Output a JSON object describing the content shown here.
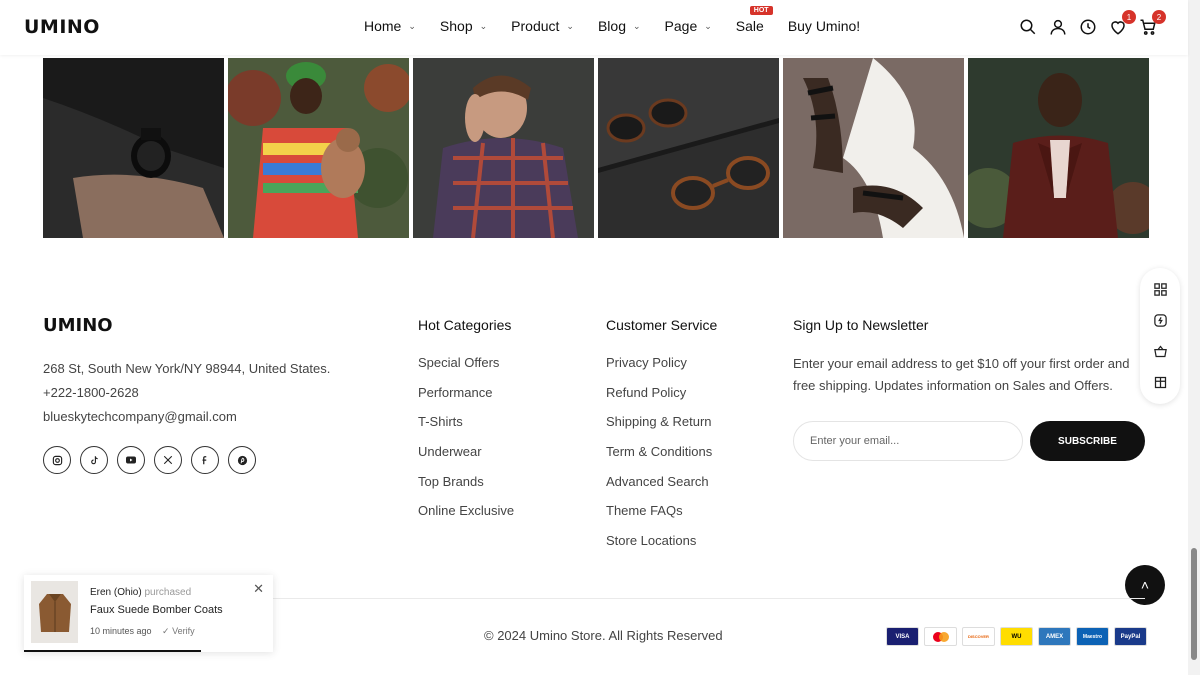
{
  "header": {
    "logo": "UMINO",
    "nav": [
      {
        "label": "Home",
        "dropdown": true
      },
      {
        "label": "Shop",
        "dropdown": true
      },
      {
        "label": "Product",
        "dropdown": true
      },
      {
        "label": "Blog",
        "dropdown": true
      },
      {
        "label": "Page",
        "dropdown": true
      },
      {
        "label": "Sale",
        "dropdown": false,
        "badge": "HOT"
      },
      {
        "label": "Buy Umino!",
        "dropdown": false
      }
    ],
    "wishlist_count": "1",
    "cart_count": "2",
    "icons": [
      "search-icon",
      "user-icon",
      "clock-icon",
      "heart-icon",
      "cart-icon"
    ]
  },
  "gallery": [
    "watch",
    "man-with-baby",
    "man-in-plaid",
    "sunglasses",
    "sandals",
    "man-in-velvet-blazer"
  ],
  "footer": {
    "logo": "UMINO",
    "address": "268 St, South New York/NY 98944, United States.",
    "phone": "+222-1800-2628",
    "email": "blueskytechcompany@gmail.com",
    "socials": [
      "instagram-icon",
      "tiktok-icon",
      "youtube-icon",
      "x-icon",
      "facebook-icon",
      "pinterest-icon"
    ],
    "hot_categories": {
      "title": "Hot Categories",
      "items": [
        "Special Offers",
        "Performance",
        "T-Shirts",
        "Underwear",
        "Top Brands",
        "Online Exclusive"
      ]
    },
    "customer_service": {
      "title": "Customer Service",
      "items": [
        "Privacy Policy",
        "Refund Policy",
        "Shipping & Return",
        "Term & Conditions",
        "Advanced Search",
        "Theme FAQs",
        "Store Locations"
      ]
    },
    "newsletter": {
      "title": "Sign Up to Newsletter",
      "text": "Enter your email address to get $10 off your first order and free shipping. Updates information on Sales and Offers.",
      "placeholder": "Enter your email...",
      "button": "SUBSCRIBE"
    },
    "copyright": "© 2024 Umino Store. All Rights Reserved",
    "payments": [
      "VISA",
      "MC",
      "DISCOVER",
      "WU",
      "AMEX",
      "Maestro",
      "PayPal"
    ]
  },
  "toast": {
    "who": "Eren (Ohio)",
    "action": "purchased",
    "product": "Faux Suede Bomber Coats",
    "time": "10 minutes ago",
    "verify": "Verify"
  },
  "colors": {
    "accent": "#d6332a",
    "dark": "#111111"
  }
}
